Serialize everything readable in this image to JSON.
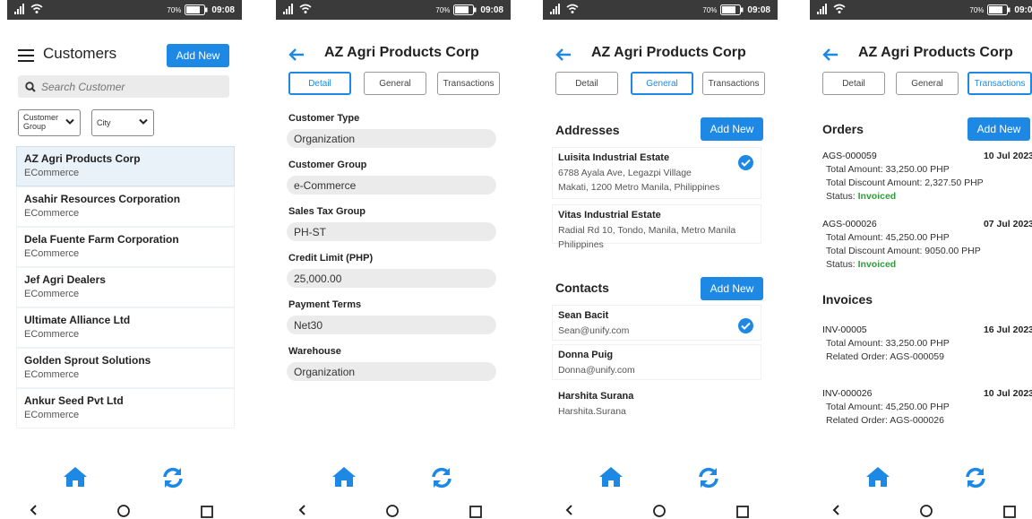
{
  "status_bar": {
    "battery_pct": "70%",
    "time": "09:08"
  },
  "colors": {
    "accent": "#1e88e5",
    "invoiced": "#2e9e3a",
    "field_bg": "#ebebeb",
    "status_bar": "#3a3a3a"
  },
  "icons": [
    "signal-icon",
    "wifi-icon",
    "battery-icon",
    "menu-icon",
    "search-icon",
    "chevron-down-icon",
    "back-arrow-icon",
    "check-circle-icon",
    "home-icon",
    "sync-icon",
    "nav-back-icon",
    "nav-home-icon",
    "nav-recent-icon"
  ],
  "customers": {
    "title": "Customers",
    "add_new": "Add New",
    "search_placeholder": "Search Customer",
    "filter_group": "Customer Group",
    "filter_city": "City",
    "items": [
      {
        "name": "AZ Agri Products Corp",
        "segment": "ECommerce"
      },
      {
        "name": "Asahir Resources Corporation",
        "segment": "ECommerce"
      },
      {
        "name": "Dela Fuente Farm Corporation",
        "segment": "ECommerce"
      },
      {
        "name": "Jef Agri Dealers",
        "segment": "ECommerce"
      },
      {
        "name": "Ultimate Alliance Ltd",
        "segment": "ECommerce"
      },
      {
        "name": "Golden Sprout Solutions",
        "segment": "ECommerce"
      },
      {
        "name": "Ankur Seed Pvt Ltd",
        "segment": "ECommerce"
      }
    ]
  },
  "detail": {
    "title": "AZ Agri Products Corp",
    "tabs": [
      "Detail",
      "General",
      "Transactions"
    ],
    "fields": [
      {
        "label": "Customer Type",
        "value": "Organization"
      },
      {
        "label": "Customer Group",
        "value": "e-Commerce"
      },
      {
        "label": "Sales Tax Group",
        "value": "PH-ST"
      },
      {
        "label": "Credit Limit (PHP)",
        "value": "25,000.00"
      },
      {
        "label": "Payment Terms",
        "value": "Net30"
      },
      {
        "label": "Warehouse",
        "value": "Organization"
      }
    ]
  },
  "general": {
    "addresses_title": "Addresses",
    "add_new": "Add New",
    "addresses": [
      {
        "name": "Luisita Industrial Estate",
        "line1": "6788 Ayala Ave, Legazpi Village",
        "line2": "Makati, 1200 Metro Manila, Philippines"
      },
      {
        "name": "Vitas Industrial Estate",
        "line1": "Radial Rd 10, Tondo, Manila, Metro Manila",
        "line2": "Philippines"
      }
    ],
    "contacts_title": "Contacts",
    "contacts": [
      {
        "name": "Sean Bacit",
        "email": "Sean@unify.com"
      },
      {
        "name": "Donna Puig",
        "email": "Donna@unify.com"
      },
      {
        "name": "Harshita Surana",
        "email": "Harshita.Surana"
      }
    ]
  },
  "transactions": {
    "orders_title": "Orders",
    "add_new": "Add New",
    "status_label": "Status:",
    "orders": [
      {
        "id": "AGS-000059",
        "date": "10 Jul 2023",
        "total": "Total Amount: 33,250.00 PHP",
        "discount": "Total Discount Amount: 2,327.50 PHP",
        "status": "Invoiced"
      },
      {
        "id": "AGS-000026",
        "date": "07 Jul 2023",
        "total": "Total Amount: 45,250.00 PHP",
        "discount": "Total Discount Amount: 9050.00 PHP",
        "status": "Invoiced"
      }
    ],
    "invoices_title": "Invoices",
    "invoices": [
      {
        "id": "INV-00005",
        "date": "16 Jul 2023",
        "total": "Total Amount: 33,250.00 PHP",
        "related": "Related Order: AGS-000059"
      },
      {
        "id": "INV-000026",
        "date": "10 Jul 2023",
        "total": "Total Amount: 45,250.00 PHP",
        "related": "Related Order: AGS-000026"
      }
    ]
  }
}
